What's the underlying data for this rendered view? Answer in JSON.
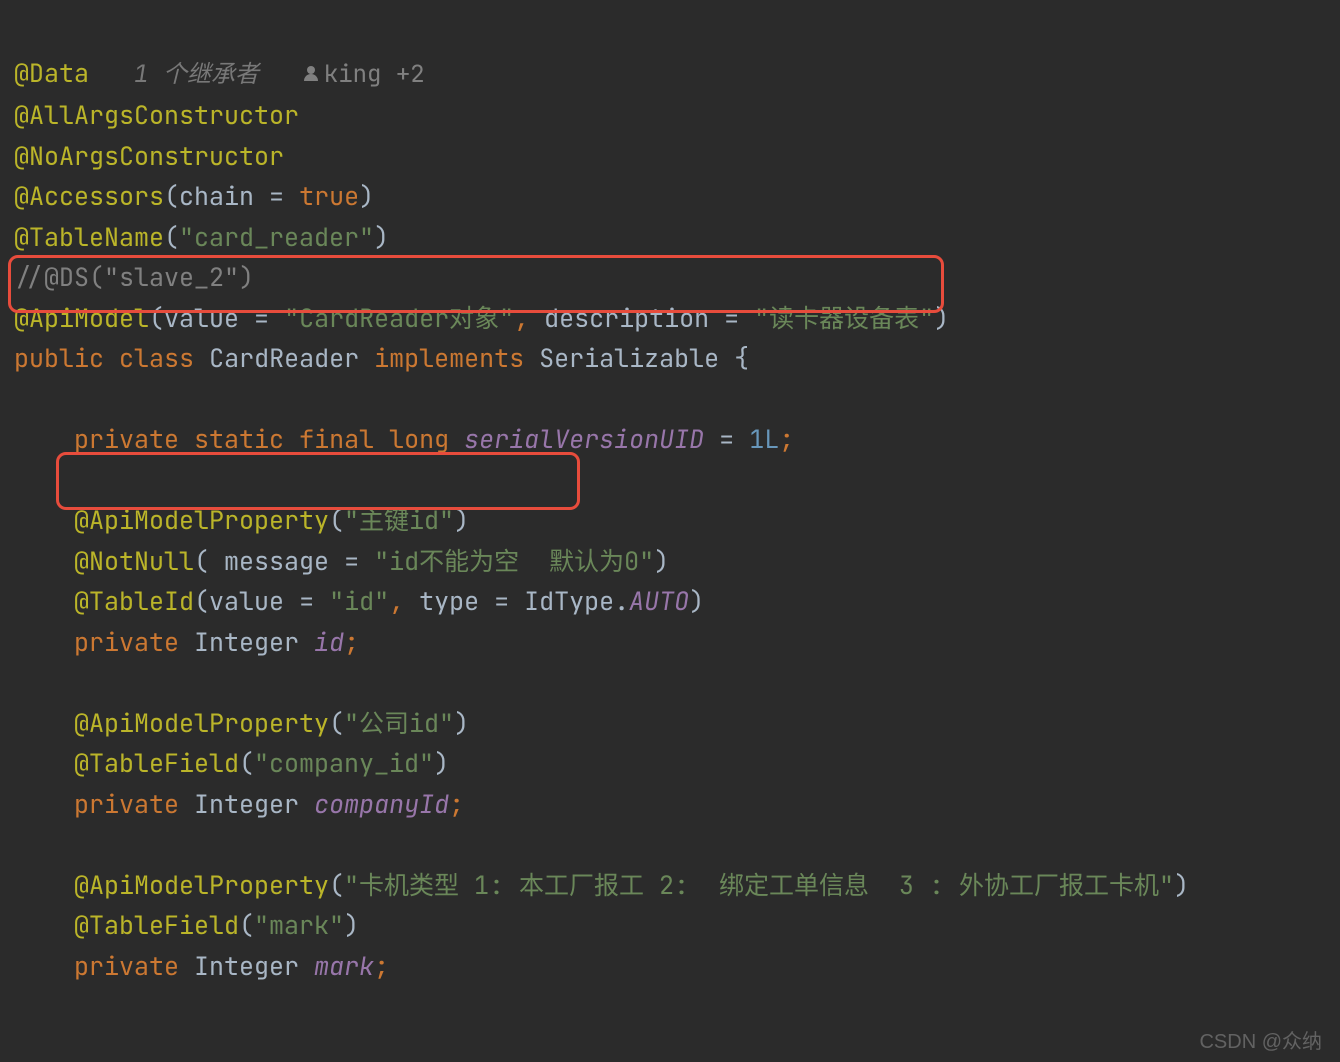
{
  "hints": {
    "inheritors": "1 个继承者",
    "author": "king +2"
  },
  "code": {
    "l1_annotation": "@Data",
    "l2_annotation": "@AllArgsConstructor",
    "l3_annotation": "@NoArgsConstructor",
    "l4_annotation": "@Accessors",
    "l4_arg_key": "chain",
    "l4_arg_val": "true",
    "l5_annotation": "@TableName",
    "l5_string": "\"card_reader\"",
    "l6_comment": "//@DS(\"slave_2\")",
    "l7_annotation": "@ApiModel",
    "l7_k1": "value",
    "l7_v1": "\"CardReader对象\"",
    "l7_k2": "description",
    "l7_v2": "\"读卡器设备表\"",
    "l8_kw1": "public",
    "l8_kw2": "class",
    "l8_name": "CardReader",
    "l8_kw3": "implements",
    "l8_iface": "Serializable",
    "l9_kw1": "private",
    "l9_kw2": "static",
    "l9_kw3": "final",
    "l9_type": "long",
    "l9_name": "serialVersionUID",
    "l9_val": "1L",
    "l10_annotation": "@ApiModelProperty",
    "l10_string": "\"主键id\"",
    "l11_annotation": "@NotNull",
    "l11_k": "message",
    "l11_v": "\"id不能为空  默认为0\"",
    "l12_annotation": "@TableId",
    "l12_k1": "value",
    "l12_v1": "\"id\"",
    "l12_k2": "type",
    "l12_v2a": "IdType",
    "l12_v2b": "AUTO",
    "l13_kw": "private",
    "l13_type": "Integer",
    "l13_name": "id",
    "l14_annotation": "@ApiModelProperty",
    "l14_string": "\"公司id\"",
    "l15_annotation": "@TableField",
    "l15_string": "\"company_id\"",
    "l16_kw": "private",
    "l16_type": "Integer",
    "l16_name": "companyId",
    "l17_annotation": "@ApiModelProperty",
    "l17_string": "\"卡机类型 1: 本工厂报工 2:  绑定工单信息  3 : 外协工厂报工卡机\"",
    "l18_annotation": "@TableField",
    "l18_string": "\"mark\"",
    "l19_kw": "private",
    "l19_type": "Integer",
    "l19_name": "mark"
  },
  "watermark": "CSDN @众纳"
}
